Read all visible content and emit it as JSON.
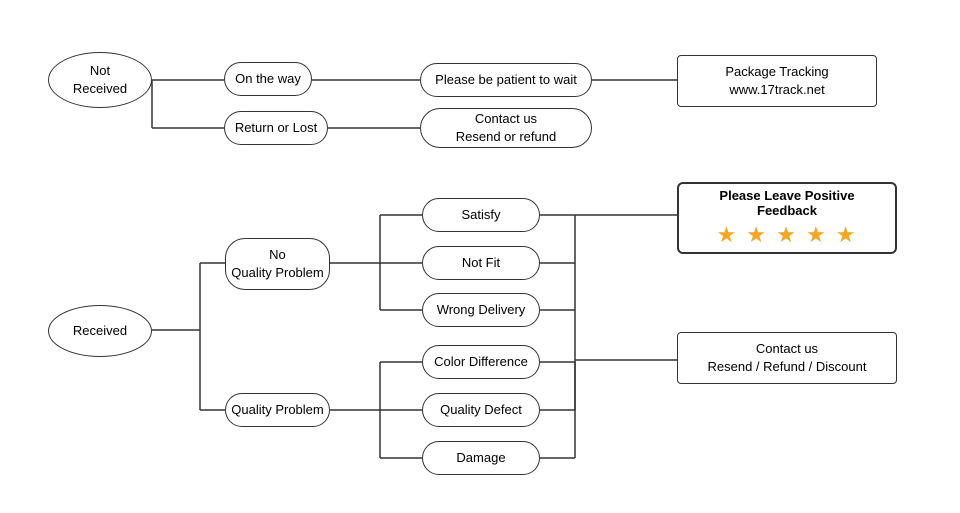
{
  "nodes": {
    "not_received": {
      "label": "Not\nReceived"
    },
    "on_the_way": {
      "label": "On the way"
    },
    "return_or_lost": {
      "label": "Return or Lost"
    },
    "please_be_patient": {
      "label": "Please be patient to wait"
    },
    "package_tracking": {
      "label": "Package Tracking\nwww.17track.net"
    },
    "contact_resend_refund": {
      "label": "Contact us\nResend or refund"
    },
    "received": {
      "label": "Received"
    },
    "no_quality_problem": {
      "label": "No\nQuality Problem"
    },
    "quality_problem": {
      "label": "Quality Problem"
    },
    "satisfy": {
      "label": "Satisfy"
    },
    "not_fit": {
      "label": "Not Fit"
    },
    "wrong_delivery": {
      "label": "Wrong Delivery"
    },
    "color_difference": {
      "label": "Color Difference"
    },
    "quality_defect": {
      "label": "Quality Defect"
    },
    "damage": {
      "label": "Damage"
    },
    "feedback_title": {
      "label": "Please Leave Positive Feedback"
    },
    "stars": {
      "label": "★ ★ ★ ★ ★"
    },
    "contact_resend_refund_discount": {
      "label": "Contact us\nResend / Refund / Discount"
    }
  }
}
